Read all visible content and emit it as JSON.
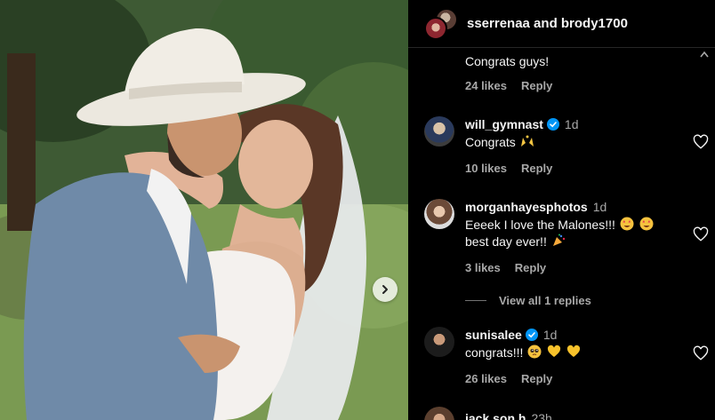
{
  "header": {
    "title": "sserrenaa and brody1700"
  },
  "comments": [
    {
      "text": "Congrats guys!",
      "likes": "24 likes",
      "reply": "Reply"
    },
    {
      "user": "will_gymnast",
      "verified": true,
      "time": "1d",
      "text": "Congrats",
      "emoji": [
        "raising-hands"
      ],
      "likes": "10 likes",
      "reply": "Reply"
    },
    {
      "user": "morganhayesphotos",
      "verified": false,
      "time": "1d",
      "text_line1": "Eeeek I love the Malones!!!",
      "text_line2": "best day ever!!",
      "emoji": [
        "star-struck",
        "star-struck",
        "party-popper"
      ],
      "likes": "3 likes",
      "reply": "Reply",
      "view_replies": "View all 1 replies"
    },
    {
      "user": "sunisalee",
      "verified": true,
      "time": "1d",
      "text": "congrats!!!",
      "emoji": [
        "pleading-face",
        "yellow-heart",
        "yellow-heart"
      ],
      "likes": "26 likes",
      "reply": "Reply"
    },
    {
      "user": "jack.son.h",
      "time": "23h"
    }
  ],
  "colors": {
    "background": "#000000",
    "text": "#f5f5f5",
    "secondary_text": "#a8a8a8",
    "verified_blue": "#0095f6"
  },
  "icons": [
    "heart-icon",
    "verified-icon",
    "chevron-right-icon",
    "chevron-up-icon"
  ]
}
